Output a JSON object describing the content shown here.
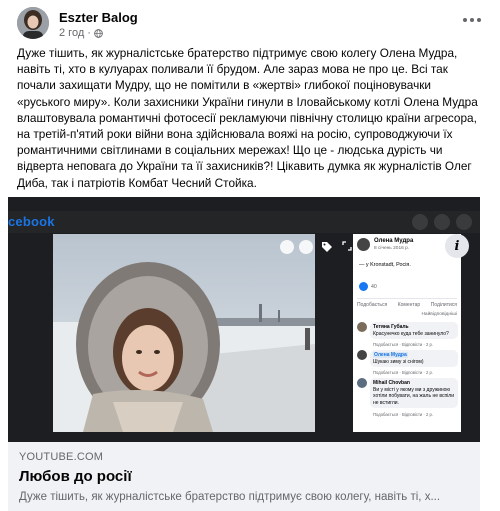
{
  "post": {
    "author": "Eszter Balog",
    "time": "2 год",
    "privacy_icon": "globe-icon",
    "more_icon": "more-options-icon",
    "text": "Дуже тішить, як журналістське братерство підтримує свою колегу Олена Мудра, навіть ті, хто в кулуарах поливали її брудом. Але зараз мова не про це. Всі так почали захищати Мудру, що не помітили в «жертві» глибокої поціновувачки «руського миру». Коли захисники України гинули в Іловайському котлі Олена Мудра влаштовувала романтичні фотосесії рекламуючи північну столицю країни агресора, на третій-п'ятий роки війни вона здійснювала вояжі на росію, супроводжуючи їх романтичними світлинами в соціальних мережах! Що це - людська дурість чи відверта неповага до України та її захисників?! Цікавить думка як журналістів Олег Диба, так і патріотів Комбат Чесний Стойка."
  },
  "media": {
    "fb_logo": "cebook",
    "side_panel": {
      "name": "Олена Мудра",
      "date": "8 січень 2016 р.",
      "caption": "— у Kronstadt, Росія.",
      "likes": "40",
      "actions": [
        "Подобається",
        "Коментар",
        "Поділитися"
      ],
      "sort": "Найвідповідніші",
      "comments": [
        {
          "author": "Тетяна Губаль",
          "text": "Красунечко куда тебе занинуло?",
          "meta": "Подобається · Відповісти · 2 р."
        },
        {
          "author": "Олена Мудра",
          "text": "Шукаю зиму зі снігом)",
          "meta": "Подобається · Відповісти · 2 р."
        },
        {
          "author": "Mihail Chovban",
          "text": "Ви у місті у якому ми з дружиною хотіли побувати, на жаль не вспіли не встигли.",
          "meta": "Подобається · Відповісти · 2 р."
        }
      ]
    }
  },
  "link": {
    "domain": "YOUTUBE.COM",
    "title": "Любов до росії",
    "description": "Дуже тішить, як журналістське братерство підтримує свою колегу, навіть ті, х..."
  },
  "colors": {
    "text_primary": "#050505",
    "text_secondary": "#65676b",
    "link_bg": "#f0f2f5",
    "fb_blue": "#1b74e4"
  }
}
